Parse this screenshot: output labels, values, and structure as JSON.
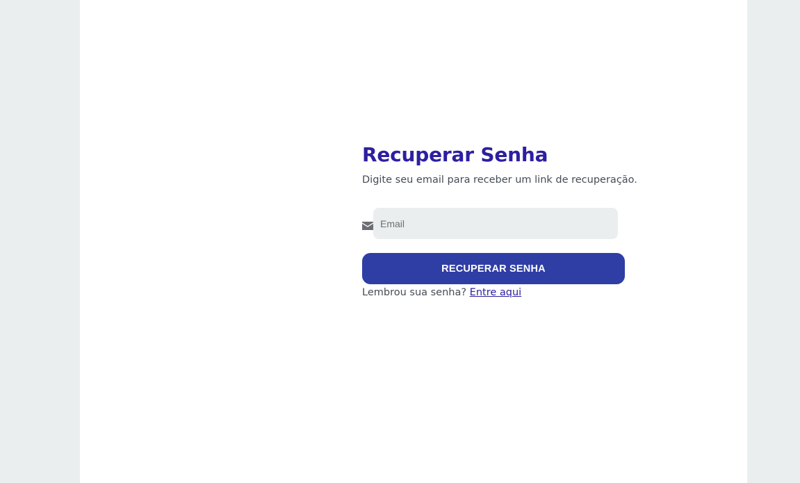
{
  "form": {
    "title": "Recuperar Senha",
    "subtitle": "Digite seu email para receber um link de recuperação.",
    "email_placeholder": "Email",
    "email_value": "",
    "email_icon": "envelope-icon",
    "submit_label": "RECUPERAR SENHA",
    "footer_text": "Lembrou sua senha?",
    "footer_link": "Entre aqui"
  },
  "colors": {
    "background": "#ebeeef",
    "card": "#ffffff",
    "title": "#2d1fa0",
    "button": "#2f3ea5",
    "input_bg": "#ebeeef",
    "icon": "#6b6f73"
  }
}
